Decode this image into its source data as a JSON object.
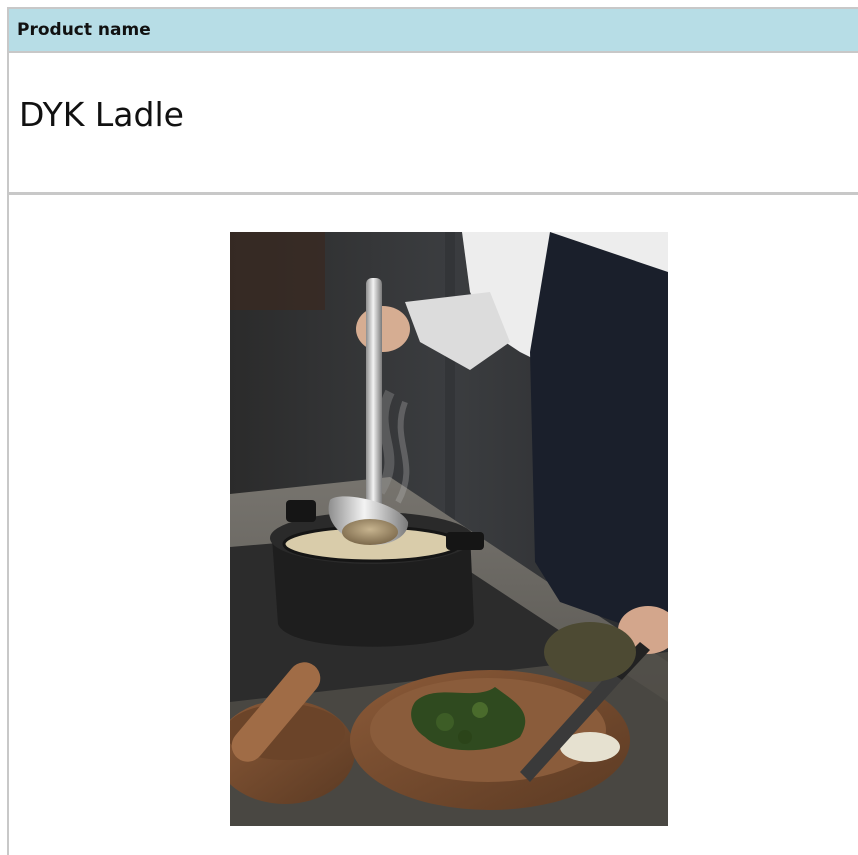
{
  "table": {
    "header_label": "Product name",
    "product_name": "DYK Ladle"
  },
  "photo": {
    "icon": "product-photo-ladle-in-pot"
  }
}
